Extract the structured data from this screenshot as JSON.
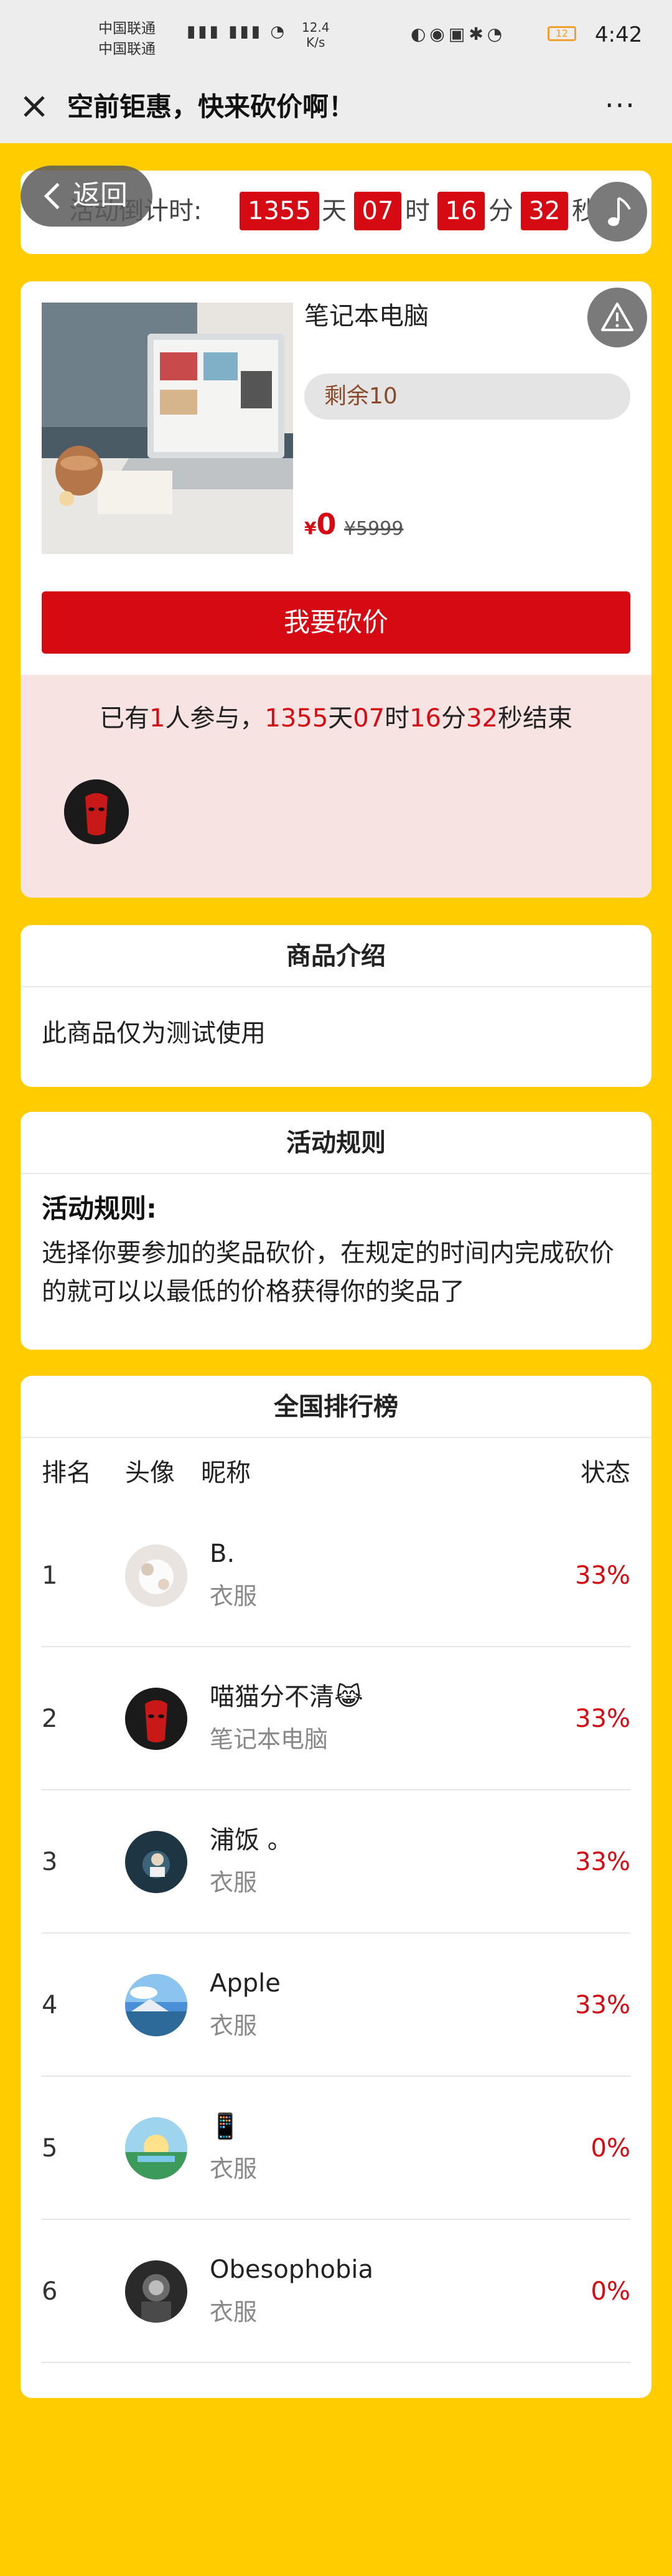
{
  "status_bar": {
    "carrier1": "中国联通",
    "carrier2": "中国联通",
    "speed_value": "12.4",
    "speed_unit": "K/s",
    "battery": "12",
    "time": "4:42"
  },
  "nav": {
    "title": "空前钜惠，快来砍价啊！",
    "more": "···"
  },
  "back_button": {
    "label": "返回"
  },
  "countdown": {
    "label": "活动倒计时:",
    "days": "1355",
    "day_unit": "天",
    "hours": "07",
    "hour_unit": "时",
    "minutes": "16",
    "minute_unit": "分",
    "seconds": "32",
    "second_unit": "秒"
  },
  "product": {
    "name": "笔记本电脑",
    "remaining": "剩余10",
    "price_symbol": "¥",
    "price": "0",
    "original_price": "¥5999",
    "cut_button": "我要砍价"
  },
  "participants": {
    "prefix": "已有",
    "count": "1",
    "mid": "人参与，",
    "days": "1355",
    "d": "天",
    "hours": "07",
    "h": "时",
    "minutes": "16",
    "m": "分",
    "seconds": "32",
    "suffix": "秒结束"
  },
  "intro": {
    "title": "商品介绍",
    "body": "此商品仅为测试使用"
  },
  "rules": {
    "title": "活动规则",
    "heading": "活动规则:",
    "body": "选择你要参加的奖品砍价，在规定的时间内完成砍价的就可以以最低的价格获得你的奖品了"
  },
  "ranking": {
    "title": "全国排行榜",
    "headers": {
      "rank": "排名",
      "avatar": "头像",
      "nickname": "昵称",
      "status": "状态"
    },
    "rows": [
      {
        "rank": "1",
        "nickname": "B.",
        "product": "衣服",
        "status": "33%"
      },
      {
        "rank": "2",
        "nickname": "喵猫分不清😹",
        "product": "笔记本电脑",
        "status": "33%"
      },
      {
        "rank": "3",
        "nickname": "浦饭 。",
        "product": "衣服",
        "status": "33%"
      },
      {
        "rank": "4",
        "nickname": "Apple",
        "product": "衣服",
        "status": "33%"
      },
      {
        "rank": "5",
        "nickname": "📱",
        "product": "衣服",
        "status": "0%"
      },
      {
        "rank": "6",
        "nickname": "Obesophobia",
        "product": "衣服",
        "status": "0%"
      }
    ]
  },
  "colors": {
    "background": "#ffcc00",
    "accent_red": "#d50a12",
    "participants_bg": "#f8e3e3"
  },
  "icons": {
    "close": "close-icon",
    "more": "more-icon",
    "back": "chevron-left-icon",
    "music": "music-note-icon",
    "warning": "warning-icon"
  }
}
